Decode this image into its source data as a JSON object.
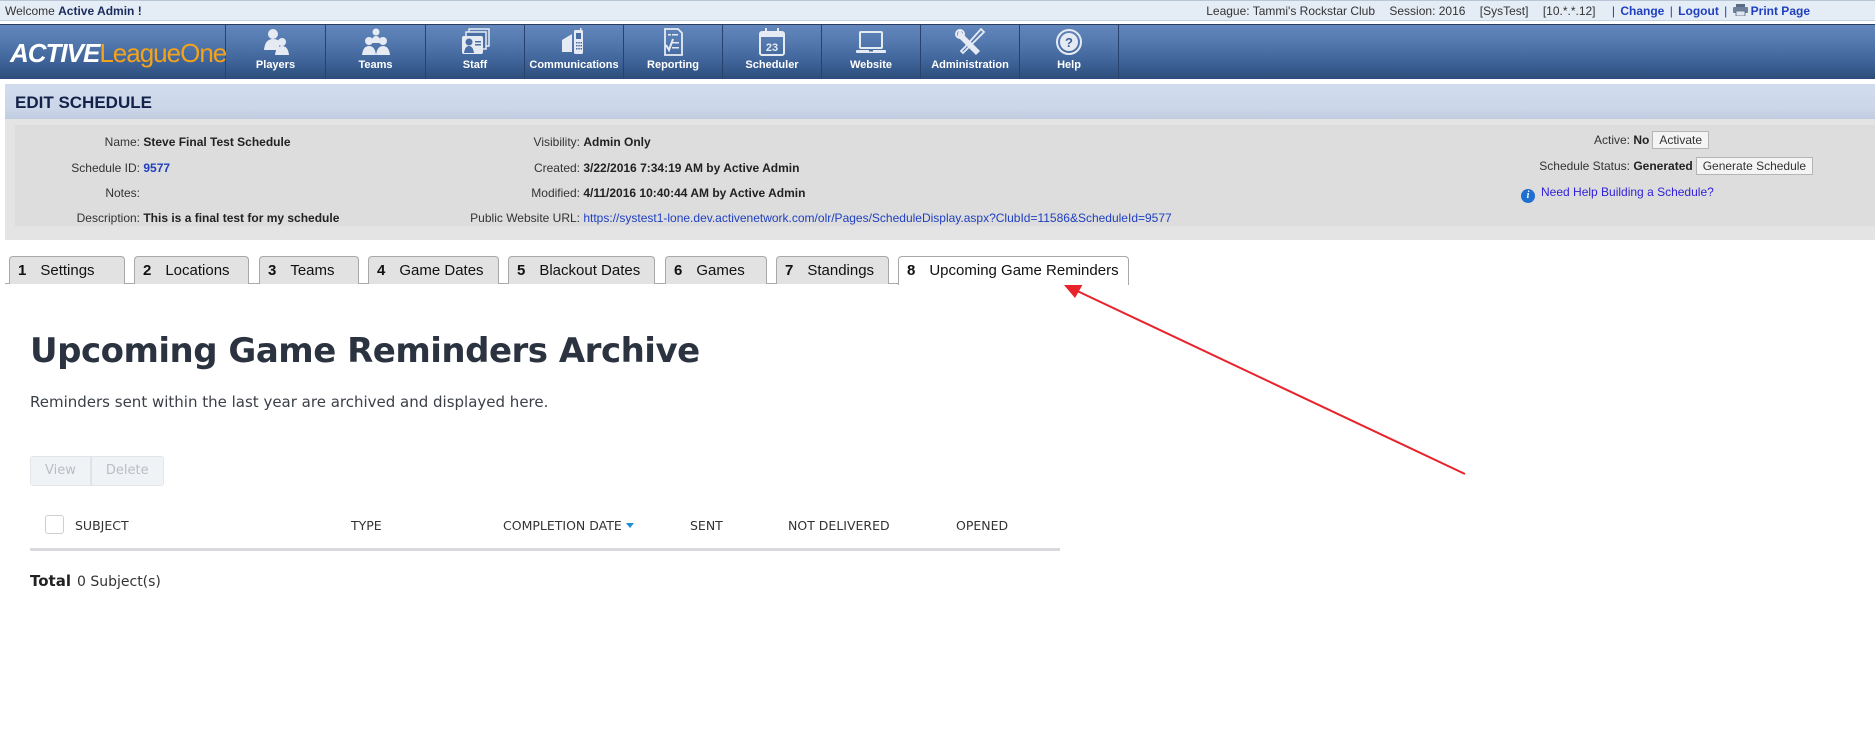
{
  "topbar": {
    "welcome_prefix": "Welcome",
    "user": "Active Admin !",
    "league": "League: Tammi's Rockstar Club",
    "session": "Session: 2016",
    "env": "[SysTest]",
    "ip": "[10.*.*.12]",
    "links": {
      "change": "Change",
      "logout": "Logout",
      "print": "Print Page"
    }
  },
  "logo": {
    "active": "ACTIVE",
    "league_one": "LeagueOne"
  },
  "nav": [
    {
      "label": "Players",
      "icon": "players-icon"
    },
    {
      "label": "Teams",
      "icon": "teams-icon"
    },
    {
      "label": "Staff",
      "icon": "staff-icon"
    },
    {
      "label": "Communications",
      "icon": "communications-icon"
    },
    {
      "label": "Reporting",
      "icon": "reporting-icon"
    },
    {
      "label": "Scheduler",
      "icon": "calendar-icon",
      "calendar_day": "23"
    },
    {
      "label": "Website",
      "icon": "laptop-icon"
    },
    {
      "label": "Administration",
      "icon": "tools-icon"
    },
    {
      "label": "Help",
      "icon": "help-icon"
    }
  ],
  "section": {
    "title": "EDIT SCHEDULE"
  },
  "schedule": {
    "name_label": "Name:",
    "name": "Steve Final Test Schedule",
    "id_label": "Schedule ID:",
    "id": "9577",
    "notes_label": "Notes:",
    "notes": "",
    "description_label": "Description:",
    "description": "This is a final test for my schedule",
    "visibility_label": "Visibility:",
    "visibility": "Admin Only",
    "created_label": "Created:",
    "created": "3/22/2016 7:34:19 AM by Active Admin",
    "modified_label": "Modified:",
    "modified": "4/11/2016 10:40:44 AM by Active Admin",
    "url_label": "Public Website URL:",
    "url": "https://systest1-lone.dev.activenetwork.com/olr/Pages/ScheduleDisplay.aspx?ClubId=11586&ScheduleId=9577",
    "active_label": "Active:",
    "active": "No",
    "activate_button": "Activate",
    "status_label": "Schedule Status:",
    "status": "Generated",
    "generate_button": "Generate Schedule",
    "help_link": "Need Help Building a Schedule?"
  },
  "tabs": [
    {
      "num": "1",
      "label": "Settings"
    },
    {
      "num": "2",
      "label": "Locations"
    },
    {
      "num": "3",
      "label": "Teams"
    },
    {
      "num": "4",
      "label": "Game Dates"
    },
    {
      "num": "5",
      "label": "Blackout Dates"
    },
    {
      "num": "6",
      "label": "Games"
    },
    {
      "num": "7",
      "label": "Standings"
    },
    {
      "num": "8",
      "label": "Upcoming Game Reminders",
      "active": true
    }
  ],
  "main": {
    "title": "Upcoming Game Reminders Archive",
    "description": "Reminders sent within the last year are archived and displayed here.",
    "buttons": {
      "view": "View",
      "delete": "Delete"
    },
    "columns": [
      "SUBJECT",
      "TYPE",
      "COMPLETION DATE",
      "SENT",
      "NOT DELIVERED",
      "OPENED"
    ],
    "sorted_column": "COMPLETION DATE",
    "total_label": "Total",
    "total_value": "0 Subject(s)"
  },
  "annotation": {
    "color": "#e8232b"
  }
}
